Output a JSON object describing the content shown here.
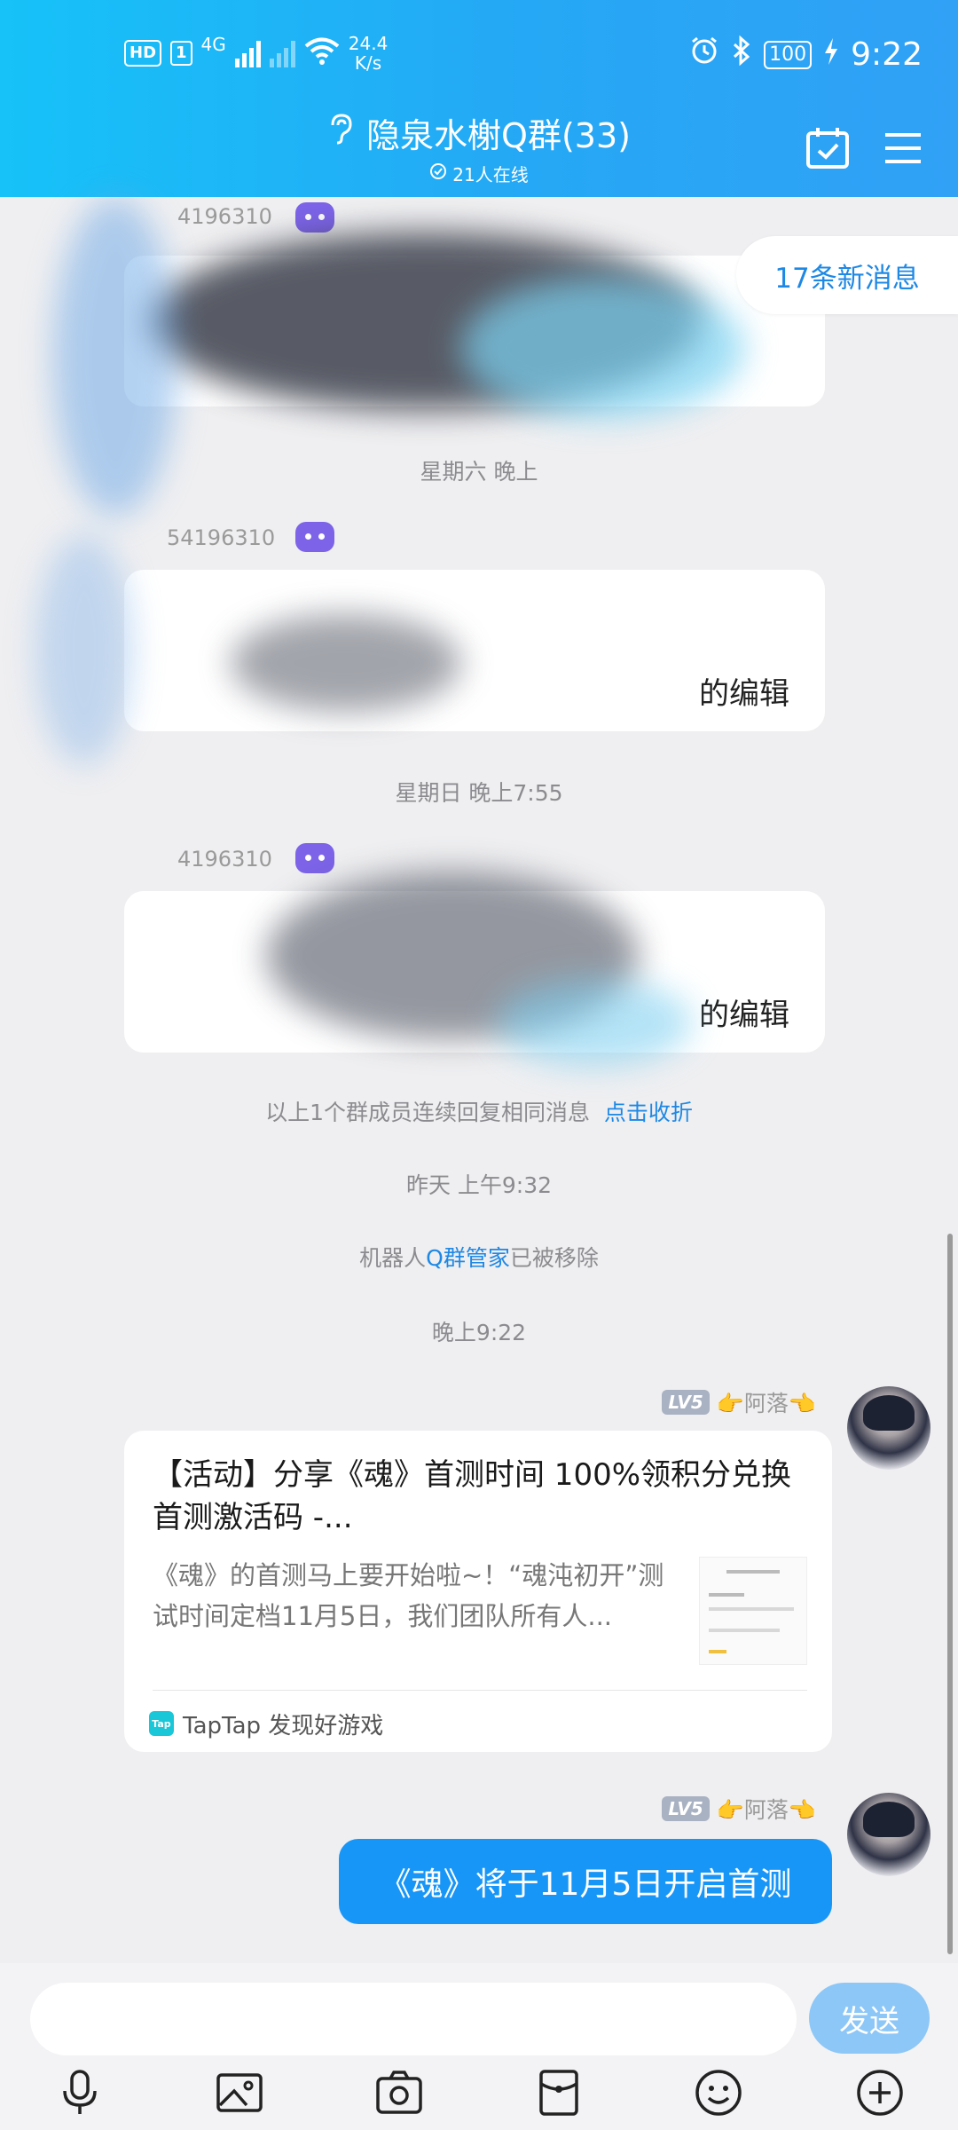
{
  "status_bar": {
    "hd": "HD",
    "sim": "1",
    "network": "4G",
    "speed_value": "24.4",
    "speed_unit": "K/s",
    "battery": "100",
    "time": "9:22"
  },
  "header": {
    "title": "隐泉水榭Q群(33)",
    "online": "21人在线"
  },
  "new_messages": "17条新消息",
  "bot_messages": [
    {
      "uid": "4196310",
      "tail": ""
    },
    {
      "uid": "54196310",
      "tail": "的编辑"
    },
    {
      "uid": "4196310",
      "tail": "的编辑"
    }
  ],
  "system": {
    "time_sat": "星期六 晚上",
    "time_sun": "星期日 晚上7:55",
    "collapse_text": "以上1个群成员连续回复相同消息",
    "collapse_link": "点击收折",
    "time_yesterday": "昨天 上午9:32",
    "removed_prefix": "机器人",
    "removed_bot": "Q群管家",
    "removed_suffix": "已被移除",
    "time_tonight": "晚上9:22"
  },
  "sender": {
    "level": "LV5",
    "name": "👉阿落👈"
  },
  "card": {
    "title": "【活动】分享《魂》首测时间 100%领积分兑换首测激活码 -...",
    "desc": "《魂》的首测马上要开始啦~！“魂沌初开”测试时间定档11月5日，我们团队所有人...",
    "source_icon": "Tap",
    "source": "TapTap 发现好游戏"
  },
  "my_message": "《魂》将于11月5日开启首测",
  "input": {
    "placeholder": "",
    "send_label": "发送"
  },
  "colors": {
    "header_gradient_start": "#16c2f8",
    "header_gradient_end": "#31a1f6",
    "accent_blue": "#1896f8",
    "link_blue": "#1e88e5",
    "send_button": "#8dc7f7",
    "bot_badge": "#7c63e8"
  },
  "icons": [
    "ear-icon",
    "verified-check-icon",
    "checkin-calendar-icon",
    "menu-icon",
    "mic-icon",
    "image-icon",
    "camera-icon",
    "red-packet-icon",
    "emoji-icon",
    "plus-icon",
    "alarm-icon",
    "bluetooth-icon",
    "wifi-icon",
    "charging-icon"
  ]
}
